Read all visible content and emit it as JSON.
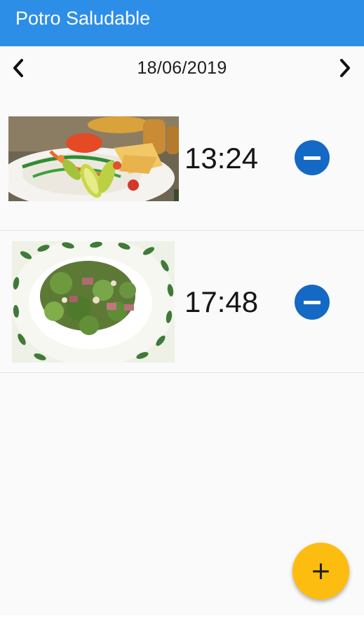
{
  "app": {
    "title": "Potro Saludable",
    "accent_color": "#2d8ee8"
  },
  "date_nav": {
    "date": "18/06/2019",
    "prev_icon": "chevron-left-icon",
    "next_icon": "chevron-right-icon"
  },
  "meals": [
    {
      "time": "13:24",
      "photo": "salad-with-vegetables-and-nachos",
      "remove_icon": "minus-circle-icon"
    },
    {
      "time": "17:48",
      "photo": "broccoli-with-ham-on-plate",
      "remove_icon": "minus-circle-icon"
    }
  ],
  "fab": {
    "label": "+",
    "icon": "plus-icon",
    "color": "#fdbd10"
  }
}
